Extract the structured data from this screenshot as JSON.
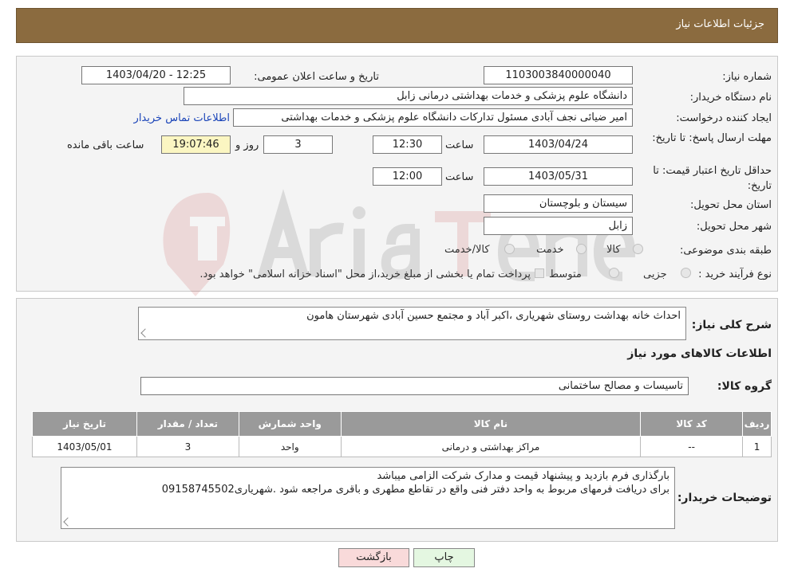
{
  "header": {
    "title": "جزئیات اطلاعات نیاز"
  },
  "details": {
    "need_number_label": "شماره نیاز:",
    "need_number": "1103003840000040",
    "announce_label": "تاریخ و ساعت اعلان عمومی:",
    "announce_value": "1403/04/20 - 12:25",
    "buyer_org_label": "نام دستگاه خریدار:",
    "buyer_org": "دانشگاه علوم پزشکی و خدمات بهداشتی درمانی زابل",
    "creator_label": "ایجاد کننده درخواست:",
    "creator": "امیر ضیائی نجف آبادی مسئول تداركات  دانشگاه علوم پزشکی و خدمات بهداشتی",
    "contact_link": "اطلاعات تماس خریدار",
    "reply_deadline_label": "مهلت ارسال پاسخ: تا تاریخ:",
    "reply_date": "1403/04/24",
    "time_label": "ساعت",
    "reply_time": "12:30",
    "days_value": "3",
    "days_label": "روز و",
    "remaining_time": "19:07:46",
    "remaining_label": "ساعت باقی مانده",
    "validity_label": "حداقل تاریخ اعتبار قیمت: تا تاریخ:",
    "validity_date": "1403/05/31",
    "validity_time": "12:00",
    "province_label": "استان محل تحویل:",
    "province": "سیستان و بلوچستان",
    "city_label": "شهر محل تحویل:",
    "city": "زابل",
    "category_label": "طبقه بندی موضوعی:",
    "category_options": [
      "کالا",
      "خدمت",
      "کالا/خدمت"
    ],
    "process_label": "نوع فرآیند خرید :",
    "process_options": [
      "جزیی",
      "متوسط"
    ],
    "payment_note": "پرداخت تمام یا بخشی از مبلغ خرید،از محل \"اسناد خزانه اسلامی\" خواهد بود."
  },
  "summary": {
    "desc_label": "شرح کلی نیاز:",
    "desc_value": "احداث خانه بهداشت روستای شهریاری ،اکبر آباد و مجتمع حسین آبادی شهرستان هامون",
    "goods_info_title": "اطلاعات کالاهای مورد نیاز",
    "group_label": "گروه کالا:",
    "group_value": "تاسیسات و مصالح ساختمانی",
    "table": {
      "headers": [
        "ردیف",
        "کد کالا",
        "نام کالا",
        "واحد شمارش",
        "تعداد / مقدار",
        "تاریخ نیاز"
      ],
      "rows": [
        [
          "1",
          "--",
          "مراکز بهداشتی و درمانی",
          "واحد",
          "3",
          "1403/05/01"
        ]
      ]
    },
    "buyer_notes_label": "توضیحات خریدار:",
    "buyer_notes_line1": "بارگذاری فرم بازدید و پیشنهاد قیمت و مدارک شرکت الزامی میباشد",
    "buyer_notes_line2": "برای دریافت فرمهای مربوط به واحد دفتر فنی واقع در تقاطع مطهری و باقری مراجعه شود .شهریاری09158745502"
  },
  "buttons": {
    "print": "چاپ",
    "back": "بازگشت"
  },
  "colors": {
    "header": "#8b6b3f",
    "remaining": "#fbf6c2",
    "back_button": "#f9dada",
    "print_button": "#e4f7e1",
    "table_header": "#9a9a9a"
  }
}
